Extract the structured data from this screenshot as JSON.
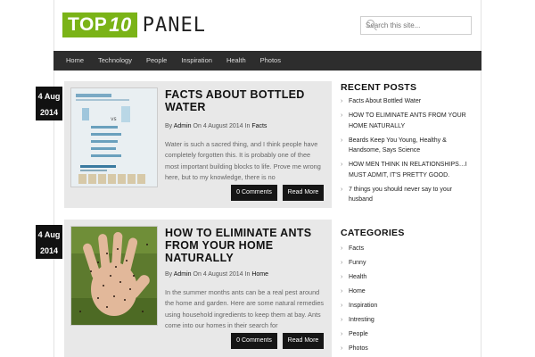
{
  "header": {
    "logo_box_text": "TOP",
    "logo_box_num": "10",
    "logo_text": "PANEL",
    "search_placeholder": "Search this site..."
  },
  "nav": {
    "items": [
      "Home",
      "Technology",
      "People",
      "Inspiration",
      "Health",
      "Photos"
    ]
  },
  "posts": [
    {
      "date_day": "4 Aug",
      "date_year": "2014",
      "title": "Facts About Bottled Water",
      "meta_by": "By",
      "author": "Admin",
      "meta_on": "On 4 August 2014 In",
      "category": "Facts",
      "excerpt": "Water is such a sacred thing, and I think people have completely forgotten this. It is probably one of thee most important building blocks to life. Prove me wrong here, but to my knowledge, there is no",
      "comments_label": "0 Comments",
      "read_more_label": "Read More"
    },
    {
      "date_day": "4 Aug",
      "date_year": "2014",
      "title": "How To Eliminate Ants From Your Home Naturally",
      "meta_by": "By",
      "author": "Admin",
      "meta_on": "On 4 August 2014 In",
      "category": "Home",
      "excerpt": "In the summer months ants can be a real pest around the home and garden. Here are some natural remedies using household ingredients to keep them at bay. Ants come into our homes in their search for",
      "comments_label": "0 Comments",
      "read_more_label": "Read More"
    }
  ],
  "sidebar": {
    "recent_title": "RECENT POSTS",
    "recent": [
      "Facts About Bottled Water",
      "HOW TO ELIMINATE ANTS FROM YOUR HOME NATURALLY",
      "Beards Keep You Young, Healthy & Handsome, Says Science",
      "HOW MEN THINK IN RELATIONSHIPS…I MUST ADMIT, IT'S PRETTY GOOD.",
      "7 things you should never say to your husband"
    ],
    "categories_title": "CATEGORIES",
    "categories": [
      "Facts",
      "Funny",
      "Health",
      "Home",
      "Inspiration",
      "Intresting",
      "People",
      "Photos"
    ]
  },
  "colors": {
    "logo_green": "#7ab317",
    "nav_bg": "#2d2d2d",
    "post_bg": "#e8e8e8",
    "button_bg": "#151515"
  }
}
